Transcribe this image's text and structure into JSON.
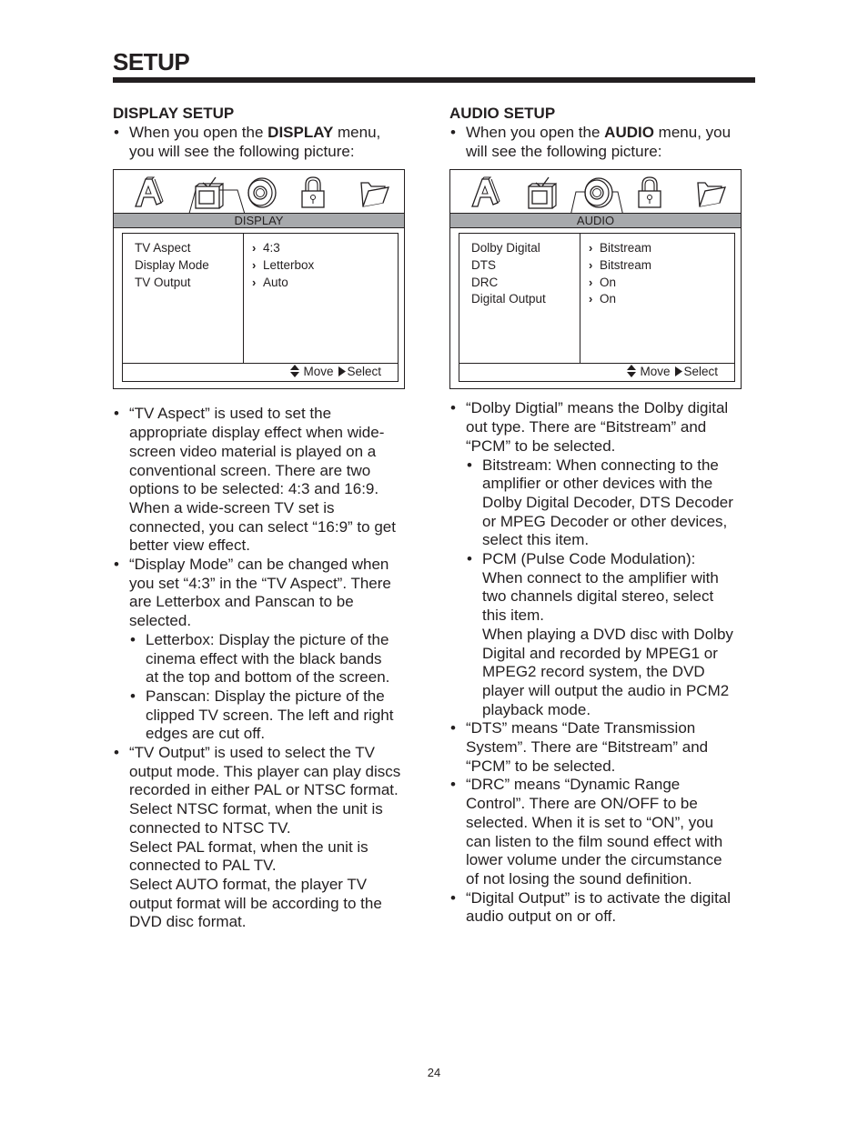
{
  "page": {
    "title": "SETUP",
    "page_number": "24"
  },
  "display_setup": {
    "heading": "DISPLAY SETUP",
    "intro": {
      "before": "When you open the ",
      "bold": "DISPLAY",
      "after_line1": " menu,",
      "line2": "you will see the following picture:"
    },
    "osd": {
      "header": "DISPLAY",
      "icons": [
        "language-icon",
        "tv-icon",
        "disc-audio-icon",
        "lock-icon",
        "folder-icon"
      ],
      "selected_icon": "tv-icon",
      "rows": [
        {
          "label": "TV Aspect",
          "value": "4:3"
        },
        {
          "label": "Display Mode",
          "value": "Letterbox"
        },
        {
          "label": "TV Output",
          "value": "Auto"
        }
      ],
      "footer": {
        "move": "Move",
        "select": "Select"
      }
    },
    "paragraphs": [
      [
        "“TV Aspect” is used to set the",
        "appropriate display effect when wide-",
        "screen video material is played on a",
        "conventional screen. There are two",
        "options to be selected: 4:3 and 16:9.",
        "When a wide-screen TV set is",
        "connected, you can select “16:9” to get",
        "better view effect."
      ],
      [
        "“Display Mode” can be changed when",
        "you set “4:3” in the “TV Aspect”. There",
        "are Letterbox and Panscan to be",
        "selected."
      ],
      [
        "Letterbox: Display the picture of the",
        "cinema effect with the black bands",
        "at the top and bottom of the screen."
      ],
      [
        "Panscan: Display the picture of the",
        "clipped TV screen. The left and right",
        "edges are cut off."
      ],
      [
        "“TV Output” is used to select the TV",
        "output mode. This player can play discs",
        "recorded in either PAL or NTSC format.",
        "Select NTSC format, when the unit is",
        "connected to NTSC TV.",
        "Select PAL format, when the unit is",
        "connected to PAL TV.",
        "Select AUTO format, the player TV",
        "output format will be according to the",
        "DVD disc format."
      ]
    ]
  },
  "audio_setup": {
    "heading": "AUDIO SETUP",
    "intro": {
      "before": "When you open the ",
      "bold": "AUDIO",
      "after_line1": " menu, you",
      "line2": "will see the following picture:"
    },
    "osd": {
      "header": "AUDIO",
      "icons": [
        "language-icon",
        "tv-icon",
        "disc-audio-icon",
        "lock-icon",
        "folder-icon"
      ],
      "selected_icon": "disc-audio-icon",
      "rows": [
        {
          "label": "Dolby Digital",
          "value": "Bitstream"
        },
        {
          "label": "DTS",
          "value": "Bitstream"
        },
        {
          "label": "DRC",
          "value": "On"
        },
        {
          "label": "Digital Output",
          "value": "On"
        }
      ],
      "footer": {
        "move": "Move",
        "select": "Select"
      }
    },
    "paragraphs": [
      [
        "“Dolby Digtial” means the Dolby digital",
        "out type. There are “Bitstream” and",
        "“PCM” to be selected."
      ],
      [
        "Bitstream: When connecting to the",
        "amplifier or other devices with the",
        "Dolby Digital Decoder, DTS Decoder",
        "or MPEG Decoder or other devices,",
        "select this item."
      ],
      [
        "PCM (Pulse Code Modulation):",
        "When connect to the amplifier with",
        "two channels digital stereo, select",
        "this item.",
        "When playing a DVD disc with Dolby",
        "Digital and recorded by MPEG1 or",
        "MPEG2 record system, the DVD",
        "player will output the audio in PCM2",
        "playback mode."
      ],
      [
        "“DTS” means “Date Transmission",
        "System”. There are “Bitstream” and",
        "“PCM” to be selected."
      ],
      [
        "“DRC” means “Dynamic Range",
        "Control”. There are ON/OFF to be",
        "selected. When it is set to “ON”, you",
        "can listen to the film sound effect with",
        "lower volume under the circumstance",
        "of not losing the sound definition."
      ],
      [
        "“Digital Output” is to activate the digital",
        "audio output on or off."
      ]
    ]
  }
}
